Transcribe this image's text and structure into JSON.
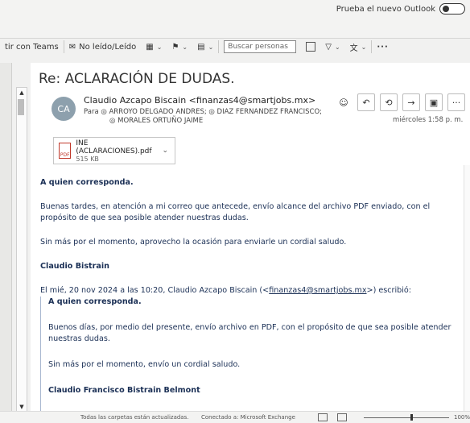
{
  "outlook_toggle": {
    "label": "Prueba el nuevo Outlook"
  },
  "toolbar": {
    "teams_label": "tir con Teams",
    "unread_label": "No leído/Leído",
    "search_placeholder": "Buscar personas"
  },
  "email": {
    "subject": "Re: ACLARACIÓN DE DUDAS.",
    "avatar_initials": "CA",
    "sender": "Claudio Azcapo Biscain <finanzas4@smartjobs.mx>",
    "to_label": "Para",
    "recipients_line1": "ARROYO DELGADO ANDRES; ◎ DIAZ FERNANDEZ FRANCISCO;",
    "recipients_line2": "MORALES ORTUÑO JAIME",
    "date": "miércoles 1:58 p. m.",
    "attachment": {
      "name": "INE (ACLARACIONES).pdf",
      "size": "515 KB"
    }
  },
  "body": {
    "greeting": "A quien corresponda.",
    "p1": "Buenas tardes, en atención a mi correo que antecede, envío alcance del archivo PDF enviado, con el",
    "p1b": "propósito de que sea posible atender nuestras dudas.",
    "p2": "Sin más por el momento, aprovecho la ocasión para enviarle un cordial saludo.",
    "signature": "Claudio Bistrain",
    "quote_header_pre": "El mié, 20 nov 2024 a las 10:20, Claudio Azcapo Biscain (<",
    "quote_header_email": "finanzas4@smartjobs.mx",
    "quote_header_post": ">) escribió:",
    "q_greeting": "A quien corresponda.",
    "q_p1": "Buenos días, por medio del presente, envío archivo en PDF, con el propósito de que sea posible atender",
    "q_p1b": "nuestras dudas.",
    "q_p2": "Sin más por el momento, envío un cordial saludo.",
    "q_signature": "Claudio Francisco Bistrain Belmont"
  },
  "statusbar": {
    "folders": "Todas las carpetas están actualizadas.",
    "connection": "Conectado a: Microsoft Exchange",
    "zoom": "100%"
  }
}
